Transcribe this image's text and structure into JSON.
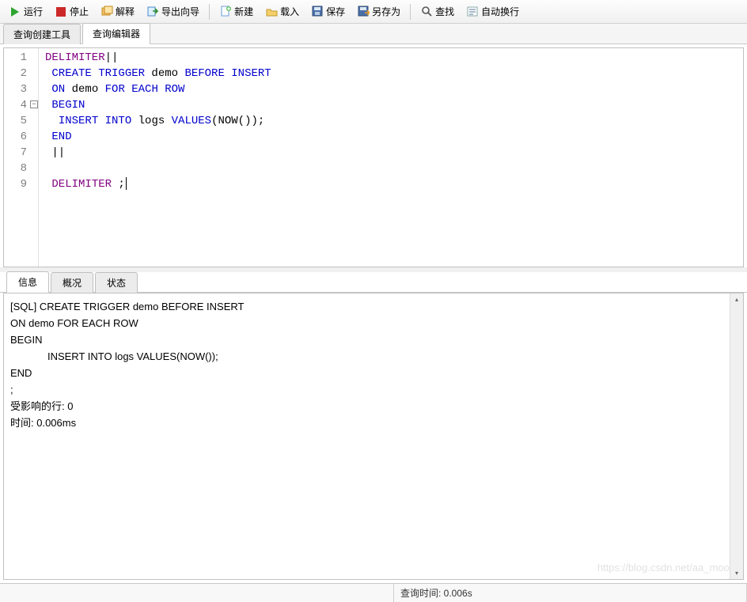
{
  "toolbar": {
    "run": "运行",
    "stop": "停止",
    "explain": "解释",
    "export_wizard": "导出向导",
    "new": "新建",
    "load": "载入",
    "save": "保存",
    "save_as": "另存为",
    "find": "查找",
    "word_wrap": "自动换行"
  },
  "main_tabs": {
    "query_builder": "查询创建工具",
    "query_editor": "查询编辑器"
  },
  "editor": {
    "lines": [
      {
        "n": "1",
        "tokens": [
          [
            "kw1",
            "DELIMITER"
          ],
          [
            " ",
            "||"
          ]
        ]
      },
      {
        "n": "2",
        "tokens": [
          [
            " ",
            " "
          ],
          [
            "kw2",
            "CREATE TRIGGER"
          ],
          [
            " ",
            " demo "
          ],
          [
            "kw2",
            "BEFORE INSERT"
          ]
        ]
      },
      {
        "n": "3",
        "tokens": [
          [
            " ",
            " "
          ],
          [
            "kw2",
            "ON"
          ],
          [
            " ",
            " demo "
          ],
          [
            "kw2",
            "FOR EACH ROW"
          ]
        ]
      },
      {
        "n": "4",
        "fold": true,
        "tokens": [
          [
            " ",
            " "
          ],
          [
            "kw2",
            "BEGIN"
          ]
        ]
      },
      {
        "n": "5",
        "tokens": [
          [
            " ",
            "  "
          ],
          [
            "kw2",
            "INSERT INTO"
          ],
          [
            " ",
            " logs "
          ],
          [
            "kw2",
            "VALUES"
          ],
          [
            "",
            "(NOW());"
          ]
        ]
      },
      {
        "n": "6",
        "tokens": [
          [
            " ",
            " "
          ],
          [
            "kw2",
            "END"
          ]
        ]
      },
      {
        "n": "7",
        "tokens": [
          [
            " ",
            " ||"
          ]
        ]
      },
      {
        "n": "8",
        "tokens": [
          [
            "",
            ""
          ]
        ]
      },
      {
        "n": "9",
        "tokens": [
          [
            " ",
            " "
          ],
          [
            "kw1",
            "DELIMITER"
          ],
          [
            "",
            " ;"
          ]
        ],
        "caret": true
      }
    ]
  },
  "result_tabs": {
    "messages": "信息",
    "profile": "概况",
    "status": "状态"
  },
  "messages": {
    "line1": "[SQL]  CREATE TRIGGER demo BEFORE INSERT",
    "line2": " ON demo FOR EACH ROW",
    "line3": " BEGIN",
    "line4": "             INSERT INTO logs VALUES(NOW());",
    "line5": " END",
    "line6": ";",
    "line7": "受影响的行: 0",
    "line8": "时间: 0.006ms"
  },
  "statusbar": {
    "query_time": "查询时间: 0.006s"
  },
  "watermark": "https://blog.csdn.net/aa_moon"
}
